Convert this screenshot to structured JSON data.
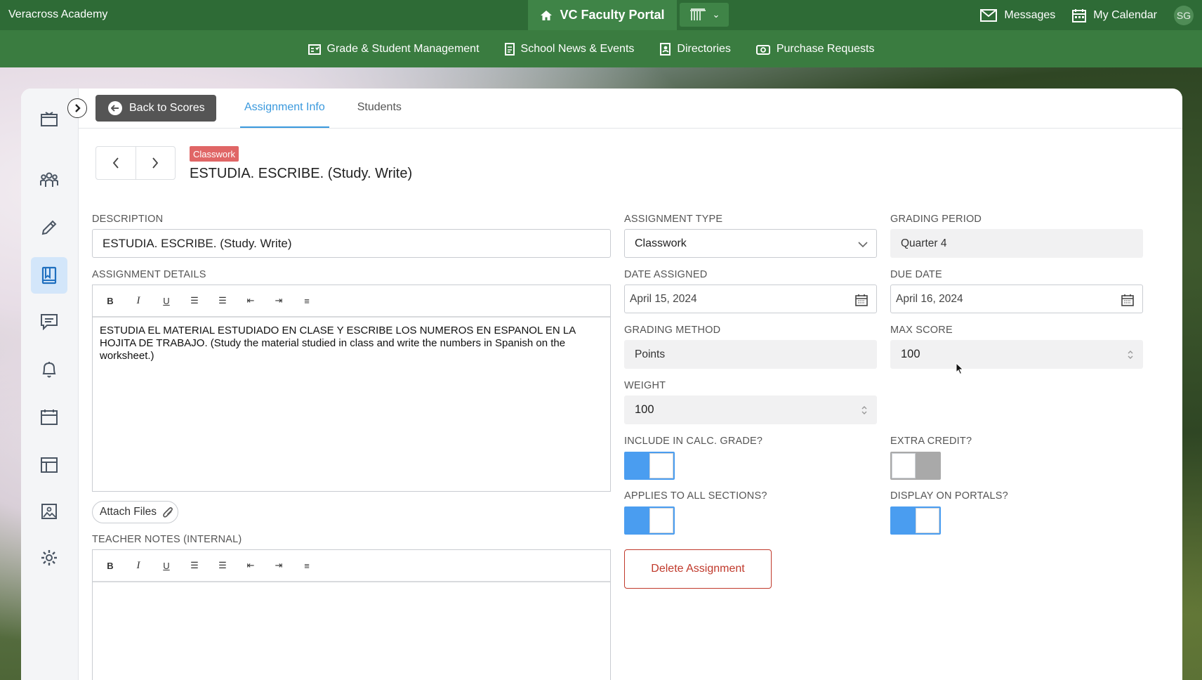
{
  "topbar": {
    "brand": "Veracross Academy",
    "portal_title": "VC Faculty Portal",
    "messages": "Messages",
    "calendar": "My Calendar",
    "avatar_initials": "SG"
  },
  "nav": {
    "items": [
      {
        "label": "Grade & Student Management",
        "icon": "gradebook-icon"
      },
      {
        "label": "School News & Events",
        "icon": "news-icon"
      },
      {
        "label": "Directories",
        "icon": "directory-icon"
      },
      {
        "label": "Purchase Requests",
        "icon": "purchase-icon"
      }
    ]
  },
  "sidebar": {
    "icons": [
      "classroom-icon",
      "people-icon",
      "pencil-icon",
      "book-icon",
      "comment-icon",
      "bell-icon",
      "calendar-icon",
      "layout-icon",
      "image-icon",
      "gear-icon"
    ],
    "active_index": 3
  },
  "header": {
    "back_label": "Back to Scores",
    "tabs": [
      {
        "label": "Assignment Info",
        "active": true
      },
      {
        "label": "Students",
        "active": false
      }
    ]
  },
  "assignment": {
    "badge": "Classwork",
    "title": "ESTUDIA. ESCRIBE. (Study. Write)"
  },
  "form": {
    "description_label": "DESCRIPTION",
    "description_value": "ESTUDIA. ESCRIBE. (Study. Write)",
    "details_label": "ASSIGNMENT DETAILS",
    "details_text": "ESTUDIA EL MATERIAL ESTUDIADO EN CLASE Y ESCRIBE LOS NUMEROS EN ESPANOL EN LA HOJITA DE TRABAJO. (Study the material studied in class and write the numbers in Spanish on the worksheet.)",
    "attach_label": "Attach Files",
    "teacher_notes_label": "TEACHER NOTES (INTERNAL)",
    "assignment_type_label": "ASSIGNMENT TYPE",
    "assignment_type_value": "Classwork",
    "grading_period_label": "GRADING PERIOD",
    "grading_period_value": "Quarter 4",
    "date_assigned_label": "DATE ASSIGNED",
    "date_assigned_value": "April 15, 2024",
    "due_date_label": "DUE DATE",
    "due_date_value": "April 16, 2024",
    "grading_method_label": "GRADING METHOD",
    "grading_method_value": "Points",
    "max_score_label": "MAX SCORE",
    "max_score_value": "100",
    "weight_label": "WEIGHT",
    "weight_value": "100",
    "include_calc_label": "INCLUDE IN CALC. GRADE?",
    "include_calc_on": true,
    "extra_credit_label": "EXTRA CREDIT?",
    "extra_credit_on": false,
    "applies_all_label": "APPLIES TO ALL SECTIONS?",
    "applies_all_on": true,
    "display_portals_label": "DISPLAY ON PORTALS?",
    "display_portals_on": true,
    "delete_label": "Delete Assignment"
  },
  "colors": {
    "topbar": "#2e6b36",
    "navbar": "#3a7c40",
    "accent": "#3a99dd",
    "toggle_on": "#4a9df0",
    "danger": "#c0392b",
    "badge": "#e06666"
  }
}
